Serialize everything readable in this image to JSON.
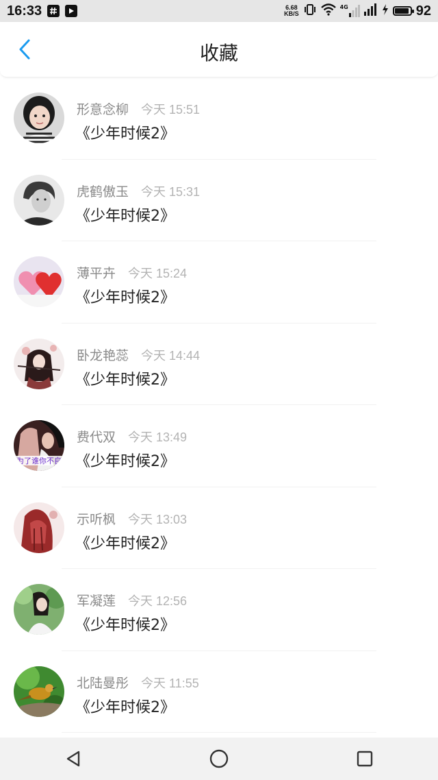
{
  "status_bar": {
    "time": "16:33",
    "net_speed_value": "6.68",
    "net_speed_unit": "KB/S",
    "network_type": "4G",
    "battery_level": "92"
  },
  "header": {
    "title": "收藏"
  },
  "favorites": [
    {
      "name": "形意念柳",
      "time": "今天 15:51",
      "content": "《少年时候2》",
      "avatar_icon": "avatar-child-photo"
    },
    {
      "name": "虎鹤傲玉",
      "time": "今天 15:31",
      "content": "《少年时候2》",
      "avatar_icon": "avatar-portrait-bw"
    },
    {
      "name": "薄平卉",
      "time": "今天 15:24",
      "content": "《少年时候2》",
      "avatar_icon": "avatar-hearts"
    },
    {
      "name": "卧龙艳蕊",
      "time": "今天 14:44",
      "content": "《少年时候2》",
      "avatar_icon": "avatar-illustration"
    },
    {
      "name": "费代双",
      "time": "今天 13:49",
      "content": "《少年时候2》",
      "avatar_icon": "avatar-girl-text",
      "avatar_caption": "为了谁你不自"
    },
    {
      "name": "示听枫",
      "time": "今天 13:03",
      "content": "《少年时候2》",
      "avatar_icon": "avatar-red-art"
    },
    {
      "name": "军凝莲",
      "time": "今天 12:56",
      "content": "《少年时候2》",
      "avatar_icon": "avatar-girl-nature"
    },
    {
      "name": "北陆曼彤",
      "time": "今天 11:55",
      "content": "《少年时候2》",
      "avatar_icon": "avatar-bird"
    }
  ],
  "colors": {
    "accent": "#1a9bf0",
    "name_text": "#8a8a8a",
    "time_text": "#b3b3b3",
    "content_text": "#222222"
  }
}
